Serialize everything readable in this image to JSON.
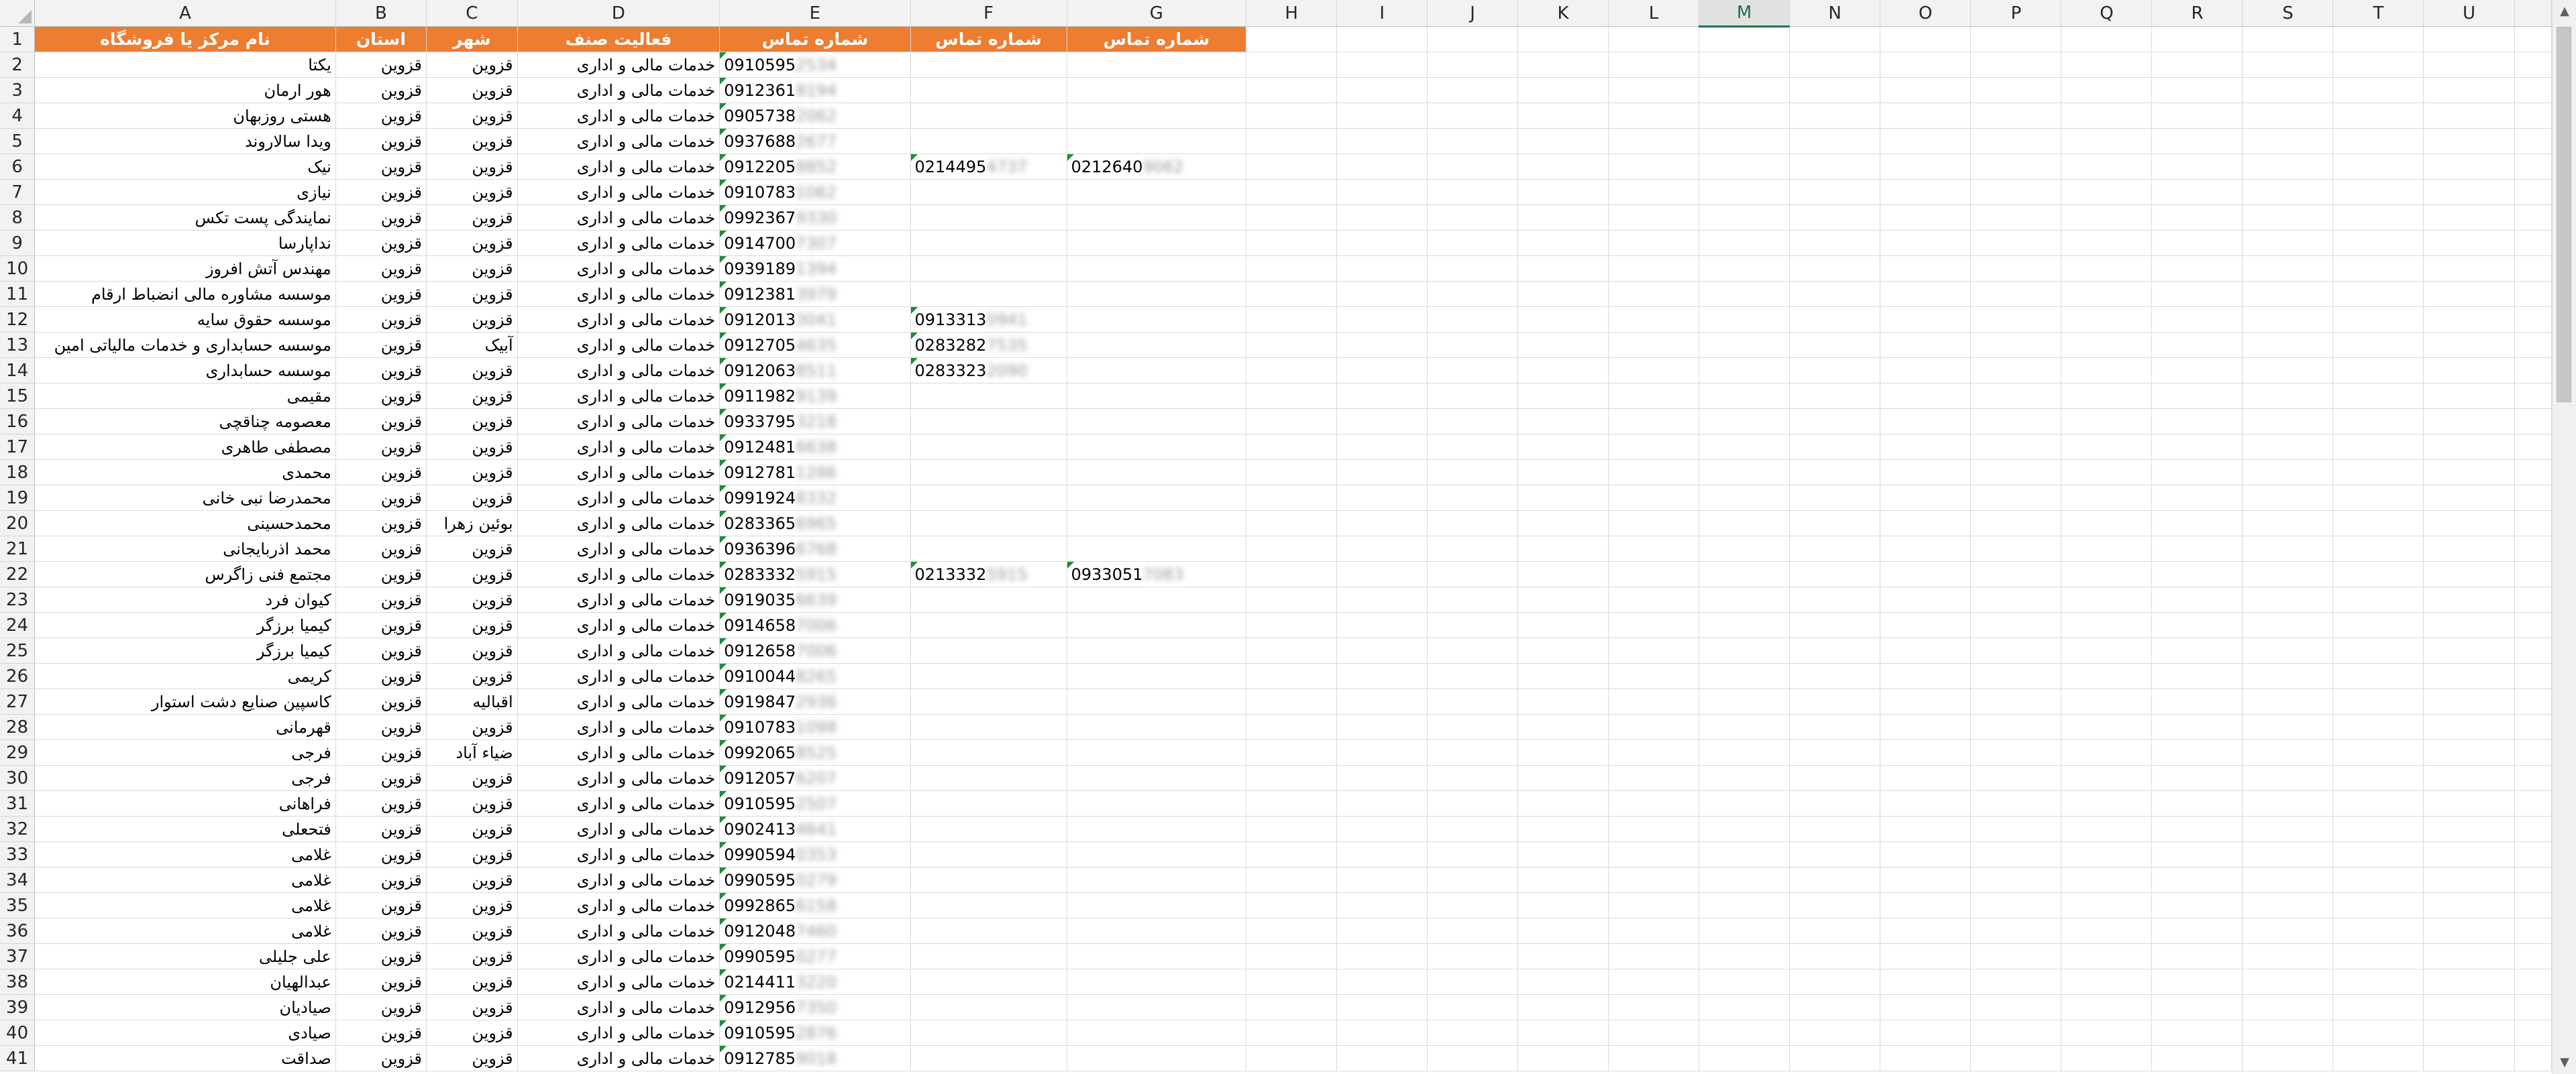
{
  "columns": [
    "A",
    "B",
    "C",
    "D",
    "E",
    "F",
    "G",
    "H",
    "I",
    "J",
    "K",
    "L",
    "M",
    "N",
    "O",
    "P",
    "Q",
    "R",
    "S",
    "T",
    "U"
  ],
  "selected_column": "M",
  "header_row": {
    "row_num": "1",
    "A": "نام مرکز یا فروشگاه",
    "B": "استان",
    "C": "شهر",
    "D": "فعالیت صنف",
    "E": "شماره تماس",
    "F": "شماره تماس",
    "G": "شماره تماس"
  },
  "rows": [
    {
      "n": "2",
      "A": "یکتا",
      "B": "قزوین",
      "C": "قزوین",
      "D": "خدمات مالی و اداری",
      "E": "0910595",
      "Eh": "2534"
    },
    {
      "n": "3",
      "A": "هور ارمان",
      "B": "قزوین",
      "C": "قزوین",
      "D": "خدمات مالی و اداری",
      "E": "0912361",
      "Eh": "8194"
    },
    {
      "n": "4",
      "A": "هستی روزبهان",
      "B": "قزوین",
      "C": "قزوین",
      "D": "خدمات مالی و اداری",
      "E": "0905738",
      "Eh": "2062"
    },
    {
      "n": "5",
      "A": "ویدا سالاروند",
      "B": "قزوین",
      "C": "قزوین",
      "D": "خدمات مالی و اداری",
      "E": "0937688",
      "Eh": "2677"
    },
    {
      "n": "6",
      "A": "نیک",
      "B": "قزوین",
      "C": "قزوین",
      "D": "خدمات مالی و اداری",
      "E": "0912205",
      "Eh": "8852",
      "F": "0214495",
      "Fh": "4737",
      "G": "0212640",
      "Gh": "9062"
    },
    {
      "n": "7",
      "A": "نیازی",
      "B": "قزوین",
      "C": "قزوین",
      "D": "خدمات مالی و اداری",
      "E": "0910783",
      "Eh": "1062"
    },
    {
      "n": "8",
      "A": "نمایندگی پست تکس",
      "B": "قزوین",
      "C": "قزوین",
      "D": "خدمات مالی و اداری",
      "E": "0992367",
      "Eh": "9330"
    },
    {
      "n": "9",
      "A": "نداپارسا",
      "B": "قزوین",
      "C": "قزوین",
      "D": "خدمات مالی و اداری",
      "E": "0914700",
      "Eh": "7307"
    },
    {
      "n": "10",
      "A": "مهندس آتش افروز",
      "B": "قزوین",
      "C": "قزوین",
      "D": "خدمات مالی و اداری",
      "E": "0939189",
      "Eh": "1394"
    },
    {
      "n": "11",
      "A": "موسسه مشاوره مالی انضباط ارقام",
      "B": "قزوین",
      "C": "قزوین",
      "D": "خدمات مالی و اداری",
      "E": "0912381",
      "Eh": "3979"
    },
    {
      "n": "12",
      "A": "موسسه حقوق سایه",
      "B": "قزوین",
      "C": "قزوین",
      "D": "خدمات مالی و اداری",
      "E": "0912013",
      "Eh": "3041",
      "F": "0913313",
      "Fh": "0941"
    },
    {
      "n": "13",
      "A": "موسسه حسابداری و خدمات مالیاتی امین",
      "B": "قزوین",
      "C": "آبیک",
      "D": "خدمات مالی و اداری",
      "E": "0912705",
      "Eh": "4635",
      "F": "0283282",
      "Fh": "7535"
    },
    {
      "n": "14",
      "A": "موسسه حسابداری",
      "B": "قزوین",
      "C": "قزوین",
      "D": "خدمات مالی و اداری",
      "E": "0912063",
      "Eh": "8511",
      "F": "0283323",
      "Fh": "2090"
    },
    {
      "n": "15",
      "A": "مقیمی",
      "B": "قزوین",
      "C": "قزوین",
      "D": "خدمات مالی و اداری",
      "E": "0911982",
      "Eh": "9139"
    },
    {
      "n": "16",
      "A": "معصومه چناقچی",
      "B": "قزوین",
      "C": "قزوین",
      "D": "خدمات مالی و اداری",
      "E": "0933795",
      "Eh": "3218"
    },
    {
      "n": "17",
      "A": "مصطفی طاهری",
      "B": "قزوین",
      "C": "قزوین",
      "D": "خدمات مالی و اداری",
      "E": "0912481",
      "Eh": "6638"
    },
    {
      "n": "18",
      "A": "محمدی",
      "B": "قزوین",
      "C": "قزوین",
      "D": "خدمات مالی و اداری",
      "E": "0912781",
      "Eh": "1286"
    },
    {
      "n": "19",
      "A": "محمدرضا نبی خانی",
      "B": "قزوین",
      "C": "قزوین",
      "D": "خدمات مالی و اداری",
      "E": "0991924",
      "Eh": "8332"
    },
    {
      "n": "20",
      "A": "محمدحسینی",
      "B": "قزوین",
      "C": "بوئین زهرا",
      "D": "خدمات مالی و اداری",
      "E": "0283365",
      "Eh": "6965"
    },
    {
      "n": "21",
      "A": "محمد اذربایجانی",
      "B": "قزوین",
      "C": "قزوین",
      "D": "خدمات مالی و اداری",
      "E": "0936396",
      "Eh": "6768"
    },
    {
      "n": "22",
      "A": "مجتمع فنی زاگرس",
      "B": "قزوین",
      "C": "قزوین",
      "D": "خدمات مالی و اداری",
      "E": "0283332",
      "Eh": "5915",
      "F": "0213332",
      "Fh": "5915",
      "G": "0933051",
      "Gh": "7083"
    },
    {
      "n": "23",
      "A": "کیوان فرد",
      "B": "قزوین",
      "C": "قزوین",
      "D": "خدمات مالی و اداری",
      "E": "0919035",
      "Eh": "6639"
    },
    {
      "n": "24",
      "A": "کیمیا برزگر",
      "B": "قزوین",
      "C": "قزوین",
      "D": "خدمات مالی و اداری",
      "E": "0914658",
      "Eh": "7006"
    },
    {
      "n": "25",
      "A": "کیمیا برزگر",
      "B": "قزوین",
      "C": "قزوین",
      "D": "خدمات مالی و اداری",
      "E": "0912658",
      "Eh": "7006"
    },
    {
      "n": "26",
      "A": "کریمی",
      "B": "قزوین",
      "C": "قزوین",
      "D": "خدمات مالی و اداری",
      "E": "0910044",
      "Eh": "8265"
    },
    {
      "n": "27",
      "A": "کاسپین صنایع دشت استوار",
      "B": "قزوین",
      "C": "اقبالیه",
      "D": "خدمات مالی و اداری",
      "E": "0919847",
      "Eh": "2936"
    },
    {
      "n": "28",
      "A": "قهرمانی",
      "B": "قزوین",
      "C": "قزوین",
      "D": "خدمات مالی و اداری",
      "E": "0910783",
      "Eh": "1098"
    },
    {
      "n": "29",
      "A": "فرجی",
      "B": "قزوین",
      "C": "ضیاء آباد",
      "D": "خدمات مالی و اداری",
      "E": "0992065",
      "Eh": "8525"
    },
    {
      "n": "30",
      "A": "فرجی",
      "B": "قزوین",
      "C": "قزوین",
      "D": "خدمات مالی و اداری",
      "E": "0912057",
      "Eh": "6207"
    },
    {
      "n": "31",
      "A": "فراهانی",
      "B": "قزوین",
      "C": "قزوین",
      "D": "خدمات مالی و اداری",
      "E": "0910595",
      "Eh": "2507"
    },
    {
      "n": "32",
      "A": "فتحعلی",
      "B": "قزوین",
      "C": "قزوین",
      "D": "خدمات مالی و اداری",
      "E": "0902413",
      "Eh": "4641"
    },
    {
      "n": "33",
      "A": "غلامی",
      "B": "قزوین",
      "C": "قزوین",
      "D": "خدمات مالی و اداری",
      "E": "0990594",
      "Eh": "0353"
    },
    {
      "n": "34",
      "A": "غلامی",
      "B": "قزوین",
      "C": "قزوین",
      "D": "خدمات مالی و اداری",
      "E": "0990595",
      "Eh": "0279"
    },
    {
      "n": "35",
      "A": "غلامی",
      "B": "قزوین",
      "C": "قزوین",
      "D": "خدمات مالی و اداری",
      "E": "0992865",
      "Eh": "6158"
    },
    {
      "n": "36",
      "A": "غلامی",
      "B": "قزوین",
      "C": "قزوین",
      "D": "خدمات مالی و اداری",
      "E": "0912048",
      "Eh": "7460"
    },
    {
      "n": "37",
      "A": "علی جلیلی",
      "B": "قزوین",
      "C": "قزوین",
      "D": "خدمات مالی و اداری",
      "E": "0990595",
      "Eh": "0277"
    },
    {
      "n": "38",
      "A": "عبدالهیان",
      "B": "قزوین",
      "C": "قزوین",
      "D": "خدمات مالی و اداری",
      "E": "0214411",
      "Eh": "3220"
    },
    {
      "n": "39",
      "A": "صیادیان",
      "B": "قزوین",
      "C": "قزوین",
      "D": "خدمات مالی و اداری",
      "E": "0912956",
      "Eh": "7350"
    },
    {
      "n": "40",
      "A": "صیادی",
      "B": "قزوین",
      "C": "قزوین",
      "D": "خدمات مالی و اداری",
      "E": "0910595",
      "Eh": "2876"
    },
    {
      "n": "41",
      "A": "صداقت",
      "B": "قزوین",
      "C": "قزوین",
      "D": "خدمات مالی و اداری",
      "E": "0912785",
      "Eh": "9018"
    }
  ],
  "scrollbar": {
    "up_arrow": "▲",
    "down_arrow": "▼"
  }
}
